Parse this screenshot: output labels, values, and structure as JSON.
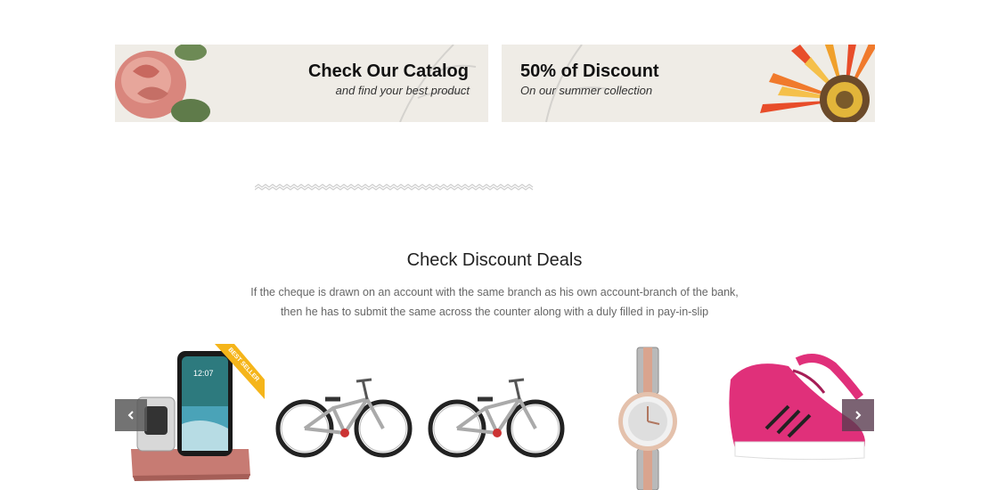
{
  "banners": [
    {
      "title": "Check Our Catalog",
      "subtitle": "and find your best product"
    },
    {
      "title": "50% of Discount",
      "subtitle": "On our summer collection"
    }
  ],
  "deals": {
    "title": "Check Discount Deals",
    "description_line1": "If the cheque is drawn on an account with the same branch as his own account-branch of the bank,",
    "description_line2": "then he has to submit the same across the counter along with a duly filled in pay-in-slip"
  },
  "products": [
    {
      "name": "phone-watch-charging-dock",
      "badge": "BEST SELLER",
      "phone_time": "12:07"
    },
    {
      "name": "bicycle-1"
    },
    {
      "name": "bicycle-2"
    },
    {
      "name": "wristwatch"
    },
    {
      "name": "pink-sneaker"
    }
  ],
  "carousel": {
    "prev_icon": "chevron-left-icon",
    "next_icon": "chevron-right-icon"
  },
  "colors": {
    "banner_bg": "#efece6",
    "badge": "#f5b51a",
    "sneaker": "#e0307a"
  }
}
